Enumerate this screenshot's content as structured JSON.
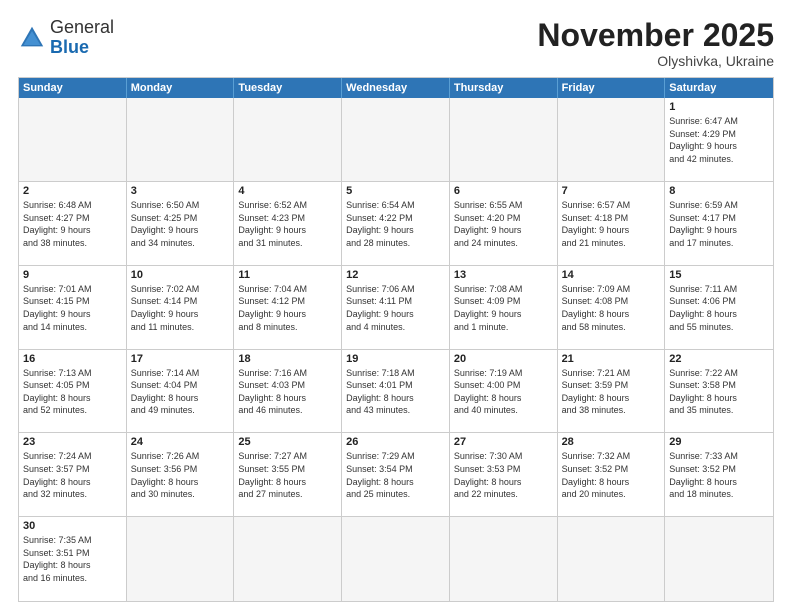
{
  "header": {
    "logo_general": "General",
    "logo_blue": "Blue",
    "month_title": "November 2025",
    "location": "Olyshivka, Ukraine"
  },
  "weekdays": [
    "Sunday",
    "Monday",
    "Tuesday",
    "Wednesday",
    "Thursday",
    "Friday",
    "Saturday"
  ],
  "cells": [
    {
      "day": "",
      "info": "",
      "empty": true
    },
    {
      "day": "",
      "info": "",
      "empty": true
    },
    {
      "day": "",
      "info": "",
      "empty": true
    },
    {
      "day": "",
      "info": "",
      "empty": true
    },
    {
      "day": "",
      "info": "",
      "empty": true
    },
    {
      "day": "",
      "info": "",
      "empty": true
    },
    {
      "day": "1",
      "info": "Sunrise: 6:47 AM\nSunset: 4:29 PM\nDaylight: 9 hours\nand 42 minutes."
    },
    {
      "day": "2",
      "info": "Sunrise: 6:48 AM\nSunset: 4:27 PM\nDaylight: 9 hours\nand 38 minutes."
    },
    {
      "day": "3",
      "info": "Sunrise: 6:50 AM\nSunset: 4:25 PM\nDaylight: 9 hours\nand 34 minutes."
    },
    {
      "day": "4",
      "info": "Sunrise: 6:52 AM\nSunset: 4:23 PM\nDaylight: 9 hours\nand 31 minutes."
    },
    {
      "day": "5",
      "info": "Sunrise: 6:54 AM\nSunset: 4:22 PM\nDaylight: 9 hours\nand 28 minutes."
    },
    {
      "day": "6",
      "info": "Sunrise: 6:55 AM\nSunset: 4:20 PM\nDaylight: 9 hours\nand 24 minutes."
    },
    {
      "day": "7",
      "info": "Sunrise: 6:57 AM\nSunset: 4:18 PM\nDaylight: 9 hours\nand 21 minutes."
    },
    {
      "day": "8",
      "info": "Sunrise: 6:59 AM\nSunset: 4:17 PM\nDaylight: 9 hours\nand 17 minutes."
    },
    {
      "day": "9",
      "info": "Sunrise: 7:01 AM\nSunset: 4:15 PM\nDaylight: 9 hours\nand 14 minutes."
    },
    {
      "day": "10",
      "info": "Sunrise: 7:02 AM\nSunset: 4:14 PM\nDaylight: 9 hours\nand 11 minutes."
    },
    {
      "day": "11",
      "info": "Sunrise: 7:04 AM\nSunset: 4:12 PM\nDaylight: 9 hours\nand 8 minutes."
    },
    {
      "day": "12",
      "info": "Sunrise: 7:06 AM\nSunset: 4:11 PM\nDaylight: 9 hours\nand 4 minutes."
    },
    {
      "day": "13",
      "info": "Sunrise: 7:08 AM\nSunset: 4:09 PM\nDaylight: 9 hours\nand 1 minute."
    },
    {
      "day": "14",
      "info": "Sunrise: 7:09 AM\nSunset: 4:08 PM\nDaylight: 8 hours\nand 58 minutes."
    },
    {
      "day": "15",
      "info": "Sunrise: 7:11 AM\nSunset: 4:06 PM\nDaylight: 8 hours\nand 55 minutes."
    },
    {
      "day": "16",
      "info": "Sunrise: 7:13 AM\nSunset: 4:05 PM\nDaylight: 8 hours\nand 52 minutes."
    },
    {
      "day": "17",
      "info": "Sunrise: 7:14 AM\nSunset: 4:04 PM\nDaylight: 8 hours\nand 49 minutes."
    },
    {
      "day": "18",
      "info": "Sunrise: 7:16 AM\nSunset: 4:03 PM\nDaylight: 8 hours\nand 46 minutes."
    },
    {
      "day": "19",
      "info": "Sunrise: 7:18 AM\nSunset: 4:01 PM\nDaylight: 8 hours\nand 43 minutes."
    },
    {
      "day": "20",
      "info": "Sunrise: 7:19 AM\nSunset: 4:00 PM\nDaylight: 8 hours\nand 40 minutes."
    },
    {
      "day": "21",
      "info": "Sunrise: 7:21 AM\nSunset: 3:59 PM\nDaylight: 8 hours\nand 38 minutes."
    },
    {
      "day": "22",
      "info": "Sunrise: 7:22 AM\nSunset: 3:58 PM\nDaylight: 8 hours\nand 35 minutes."
    },
    {
      "day": "23",
      "info": "Sunrise: 7:24 AM\nSunset: 3:57 PM\nDaylight: 8 hours\nand 32 minutes."
    },
    {
      "day": "24",
      "info": "Sunrise: 7:26 AM\nSunset: 3:56 PM\nDaylight: 8 hours\nand 30 minutes."
    },
    {
      "day": "25",
      "info": "Sunrise: 7:27 AM\nSunset: 3:55 PM\nDaylight: 8 hours\nand 27 minutes."
    },
    {
      "day": "26",
      "info": "Sunrise: 7:29 AM\nSunset: 3:54 PM\nDaylight: 8 hours\nand 25 minutes."
    },
    {
      "day": "27",
      "info": "Sunrise: 7:30 AM\nSunset: 3:53 PM\nDaylight: 8 hours\nand 22 minutes."
    },
    {
      "day": "28",
      "info": "Sunrise: 7:32 AM\nSunset: 3:52 PM\nDaylight: 8 hours\nand 20 minutes."
    },
    {
      "day": "29",
      "info": "Sunrise: 7:33 AM\nSunset: 3:52 PM\nDaylight: 8 hours\nand 18 minutes."
    },
    {
      "day": "30",
      "info": "Sunrise: 7:35 AM\nSunset: 3:51 PM\nDaylight: 8 hours\nand 16 minutes."
    },
    {
      "day": "",
      "info": "",
      "empty": true
    },
    {
      "day": "",
      "info": "",
      "empty": true
    },
    {
      "day": "",
      "info": "",
      "empty": true
    },
    {
      "day": "",
      "info": "",
      "empty": true
    },
    {
      "day": "",
      "info": "",
      "empty": true
    },
    {
      "day": "",
      "info": "",
      "empty": true
    }
  ]
}
